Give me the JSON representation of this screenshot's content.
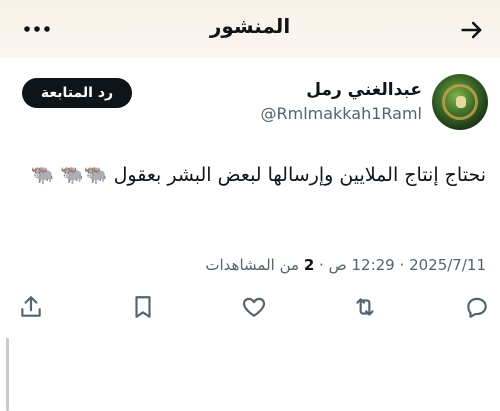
{
  "header": {
    "title": "المنشور",
    "back_icon": "arrow-right-icon",
    "more_icon": "more-horizontal-icon"
  },
  "author": {
    "name": "عبدالغني رمل",
    "handle": "@Rmlmakkah1Raml"
  },
  "follow_button": {
    "label": "رد المتابعة"
  },
  "tweet": {
    "text": "نحتاج إنتاج الملايين وإرسالها لبعض البشر بعقول 🐃🐃 🐃"
  },
  "meta": {
    "date": "2025/7/11",
    "separator": "·",
    "time": "12:29 ص",
    "views_count": "2",
    "views_label": "من المشاهدات"
  },
  "actions": [
    {
      "name": "reply",
      "icon": "reply-icon"
    },
    {
      "name": "retweet",
      "icon": "retweet-icon"
    },
    {
      "name": "like",
      "icon": "heart-icon"
    },
    {
      "name": "bookmark",
      "icon": "bookmark-icon"
    },
    {
      "name": "share",
      "icon": "share-icon"
    }
  ],
  "colors": {
    "text": "#0f1419",
    "secondary": "#536471",
    "header_bg": "#f7f1e8",
    "button_bg": "#0f1419"
  }
}
